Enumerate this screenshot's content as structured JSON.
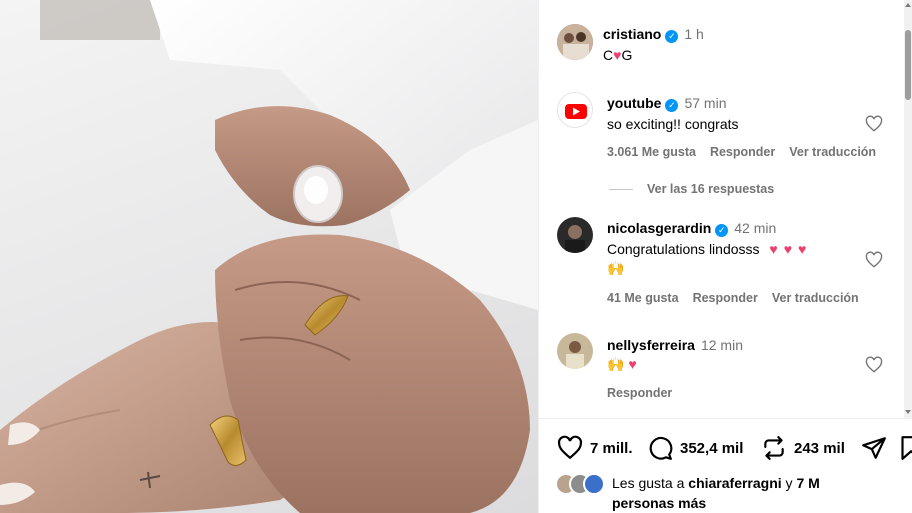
{
  "post": {
    "author": "cristiano",
    "time": "1 h",
    "caption_left": "C",
    "caption_right": "G"
  },
  "comments": [
    {
      "user": "youtube",
      "time": "57 min",
      "text": "so exciting!! congrats",
      "likes": "3.061 Me gusta",
      "reply": "Responder",
      "translate": "Ver traducción"
    },
    {
      "user": "nicolasgerardin",
      "time": "42 min",
      "text": "Congratulations lindosss",
      "likes": "41 Me gusta",
      "reply": "Responder",
      "translate": "Ver traducción"
    },
    {
      "user": "nellysferreira",
      "time": "12 min",
      "reply": "Responder"
    }
  ],
  "view_replies": "Ver las 16 respuestas",
  "actions": {
    "likes_count": "7 mill.",
    "comments_count": "352,4 mil",
    "reposts_count": "243 mil"
  },
  "liked_by": {
    "prefix": "Les gusta a",
    "user": "chiaraferragni",
    "connector": "y",
    "others": "7 M",
    "suffix": "personas más"
  },
  "colors": {
    "verified": "#0095f6",
    "heart_emoji": "#ed3f6c",
    "youtube_red": "#ff0000",
    "secondary_text": "#737373"
  },
  "icons": [
    "verified-badge-icon",
    "heart-icon",
    "comment-icon",
    "repost-icon",
    "share-icon",
    "bookmark-icon",
    "youtube-logo-icon"
  ]
}
